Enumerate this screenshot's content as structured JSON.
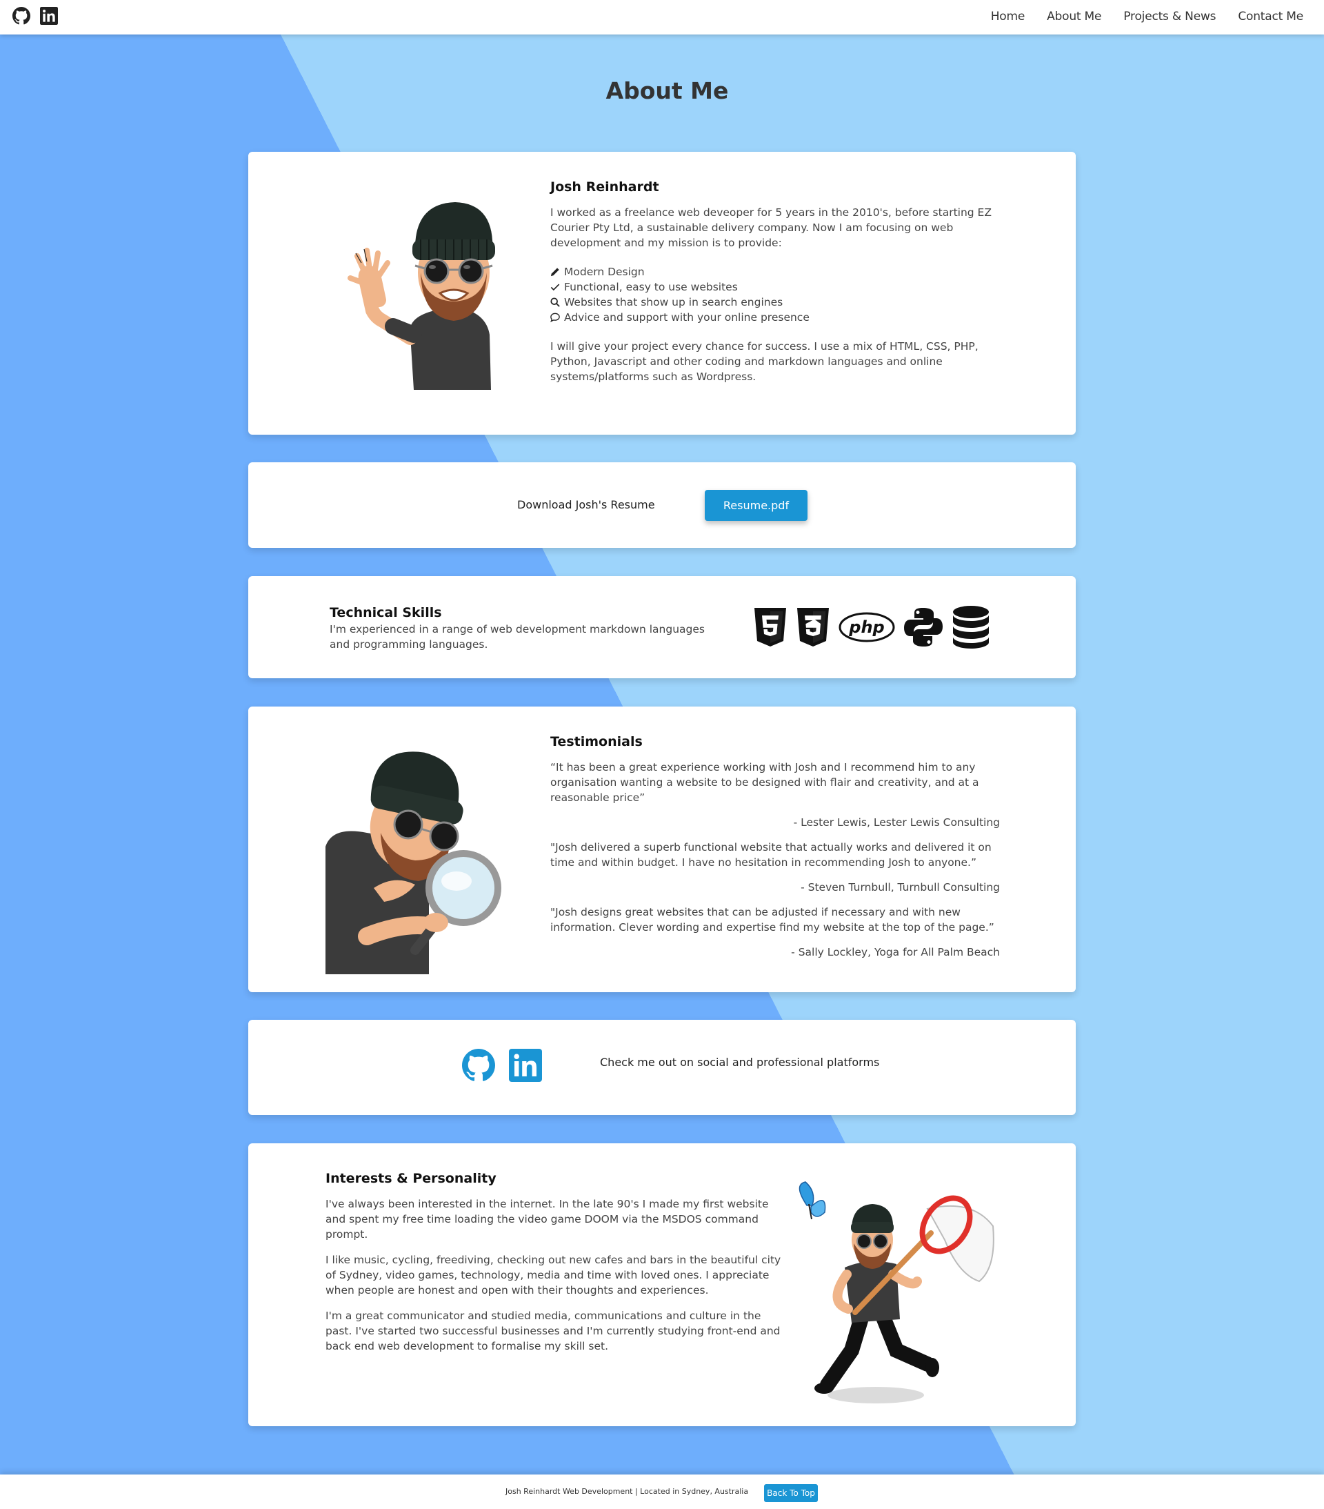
{
  "header": {
    "social_icons": [
      "github-icon",
      "linkedin-icon"
    ],
    "nav": [
      {
        "label": "Home"
      },
      {
        "label": "About Me"
      },
      {
        "label": "Projects & News"
      },
      {
        "label": "Contact Me"
      }
    ]
  },
  "page_title": "About Me",
  "about": {
    "name": "Josh Reinhardt",
    "intro": "I worked as a freelance web deveoper for 5 years in the 2010's, before starting EZ Courier Pty Ltd, a sustainable delivery company. Now I am focusing on web development and my mission is to provide:",
    "items": [
      {
        "icon": "pencil-icon",
        "label": "Modern Design"
      },
      {
        "icon": "check-icon",
        "label": "Functional, easy to use websites"
      },
      {
        "icon": "search-icon",
        "label": "Websites that show up in search engines"
      },
      {
        "icon": "chat-icon",
        "label": "Advice and support with your online presence"
      }
    ],
    "closing": "I will give your project every chance for success. I use a mix of HTML, CSS, PHP, Python, Javascript and other coding and markdown languages and online systems/platforms such as Wordpress."
  },
  "resume": {
    "label": "Download Josh's Resume",
    "button": "Resume.pdf"
  },
  "skills": {
    "title": "Technical Skills",
    "text": "I'm experienced in a range of web development markdown languages and programming languages.",
    "icons": [
      "html5-icon",
      "css3-icon",
      "php-icon",
      "python-icon",
      "database-icon"
    ],
    "php_label": "php"
  },
  "testimonials": {
    "title": "Testimonials",
    "items": [
      {
        "quote": "“It has been a great experience working with Josh and I recommend him to any organisation wanting a website to be designed with flair and creativity, and at a reasonable price”",
        "author": "- Lester Lewis, Lester Lewis Consulting"
      },
      {
        "quote": "\"Josh delivered a superb functional website that actually works and delivered it on time and within budget. I have no hesitation in recommending Josh to anyone.”",
        "author": "- Steven Turnbull, Turnbull Consulting"
      },
      {
        "quote": "\"Josh designs great websites that can be adjusted if necessary and with new information. Clever wording and expertise find my website at the top of the page.”",
        "author": "- Sally Lockley, Yoga for All Palm Beach"
      }
    ]
  },
  "social": {
    "icons": [
      "github-icon",
      "linkedin-icon"
    ],
    "label": "Check me out on social and professional platforms"
  },
  "interests": {
    "title": "Interests & Personality",
    "paragraphs": [
      "I've always been interested in the internet. In the late 90's I made my first website and spent my free time loading the video game DOOM via the MSDOS command prompt.",
      "I like music, cycling, freediving, checking out new cafes and bars in the beautiful city of Sydney, video games, technology, media and time with loved ones. I appreciate when people are honest and open with their thoughts and experiences.",
      "I'm a great communicator and studied media, communications and culture in the past. I've started two successful businesses and I'm currently studying front-end and back end web development to formalise my skill set."
    ]
  },
  "footer": {
    "text": "Josh Reinhardt Web Development | Located in Sydney, Australia",
    "button": "Back To Top"
  },
  "colors": {
    "accent": "#1a95d4",
    "bg_dark": "#6eaefc",
    "bg_light": "#9dd4fb"
  }
}
